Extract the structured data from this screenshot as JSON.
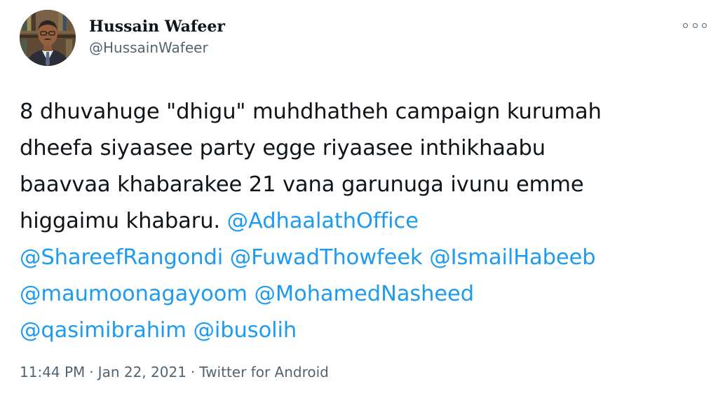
{
  "author": {
    "display_name": "Hussain Wafeer",
    "handle": "@HussainWafeer",
    "avatar_icon": "profile-photo"
  },
  "more_icon": "more-horizontal-icon",
  "tweet": {
    "text_lines": [
      "8 dhuvahuge \"dhigu\" muhdhatheh campaign kurumah",
      "dheefa siyaasee party egge riyaasee inthikhaabu",
      "baavvaa khabarakee 21 vana garunuga ivunu emme",
      "higgaimu khabaru."
    ],
    "mentions": [
      "@AdhaalathOffice",
      "@ShareefRangondi",
      "@FuwadThowfeek",
      "@IsmailHabeeb",
      "@maumoonagayoom",
      "@MohamedNasheed",
      "@qasimibrahim",
      "@ibusolih"
    ]
  },
  "meta": {
    "time": "11:44 PM",
    "separator": "·",
    "date": "Jan 22, 2021",
    "source": "Twitter for Android"
  },
  "colors": {
    "text": "#0f1419",
    "secondary": "#536471",
    "link": "#1d9bf0",
    "background": "#ffffff"
  }
}
